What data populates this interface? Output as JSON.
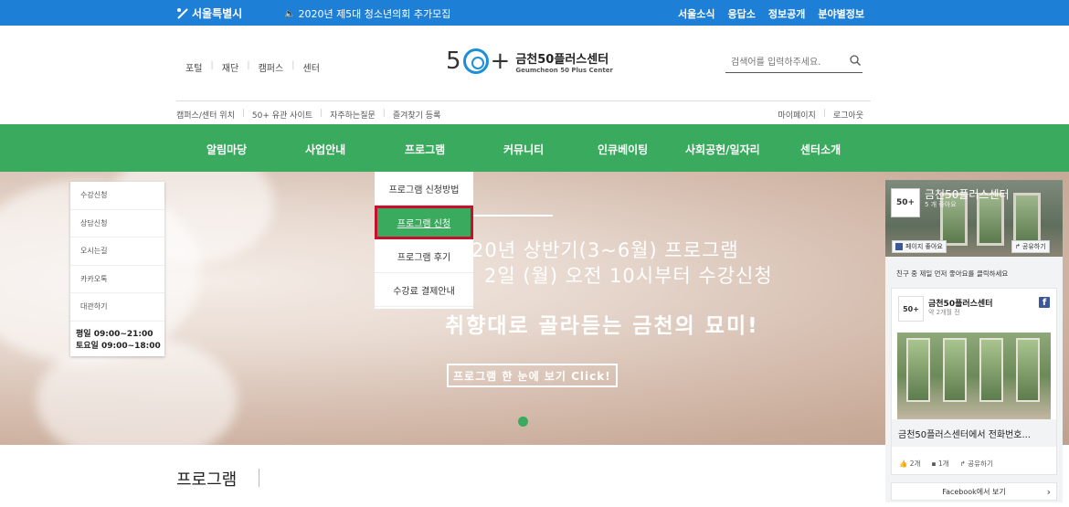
{
  "topbar": {
    "seoul": "서울특별시",
    "notice": "2020년 제5대 청소년의회 추가모집",
    "links": [
      "서울소식",
      "응답소",
      "정보공개",
      "분야별정보"
    ]
  },
  "util_nav": [
    "포털",
    "재단",
    "캠퍼스",
    "센터"
  ],
  "brand": {
    "mark_left": "5",
    "mark_right": "+",
    "name_ko": "금천50플러스센터",
    "name_en": "Geumcheon 50 Plus Center"
  },
  "search": {
    "placeholder": "검색어를 입력하주세요."
  },
  "sub_nav": [
    "캠퍼스/센터 위치",
    "50+ 유관 사이트",
    "자주하는질문",
    "즐겨찾기 등록"
  ],
  "user_nav": [
    "마이페이지",
    "로그아웃"
  ],
  "gnb": [
    "알림마당",
    "사업안내",
    "프로그램",
    "커뮤니티",
    "인큐베이팅",
    "사회공헌/일자리",
    "센터소개"
  ],
  "dropdown": {
    "items": [
      "프로그램 신청방법",
      "프로그램 신청",
      "프로그램 후기",
      "수강료 결제안내"
    ],
    "active_index": 1
  },
  "quick_menu": {
    "items": [
      "수강신청",
      "상담신청",
      "오시는길",
      "카카오톡",
      "대관하기"
    ],
    "hours_weekday": "평일 09:00~21:00",
    "hours_saturday": "토요일 09:00~18:00"
  },
  "hero": {
    "line1": "20년 상반기(3~6월) 프로그램",
    "line2": "2일 (월) 오전 10시부터 수강신청",
    "line3": "취향대로 골라듣는 금천의 묘미!",
    "cta": "프로그램 한 눈에 보기 Click!"
  },
  "facebook": {
    "page_name": "금천50플러스센터",
    "likes": "5 개 좋아요",
    "like_btn": "페이지 좋아요",
    "share_btn": "공유하기",
    "friend_text": "친구 중 제일 먼저 좋아요를 클릭하세요",
    "post_name": "금천50플러스센터",
    "post_time": "약 2개월 전",
    "post_caption": "금천50플러스센터에서 전화번호...",
    "reactions": "2개",
    "comments": "1개",
    "share": "공유하기",
    "footer": "Facebook에서 보기"
  },
  "section_title": "프로그램",
  "colors": {
    "topbar": "#1d7fd6",
    "gnb": "#3aab5e",
    "active_outline": "#c8102e"
  }
}
